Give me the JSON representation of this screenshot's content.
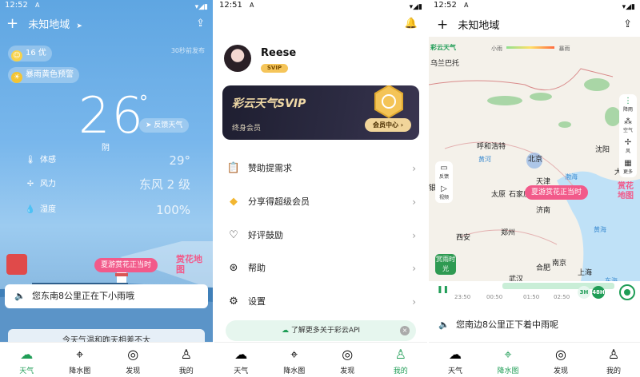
{
  "screen1": {
    "status": {
      "time": "12:52",
      "sim": "A"
    },
    "location": "未知地域",
    "aqi": "16 优",
    "alert": "暴雨黄色预警",
    "update": "30秒前发布",
    "temp": "26",
    "degree": "°",
    "feedback": "反馈天气",
    "condition": "阴",
    "details": [
      {
        "label": "体感",
        "value": "29°"
      },
      {
        "label": "风力",
        "value": "东风 2 级"
      },
      {
        "label": "湿度",
        "value": "100%"
      }
    ],
    "promo": "夏游赏花正当时",
    "promo_logo": "赏花地图",
    "notice": "您东南8公里正在下小雨哦",
    "summary": "今天气温和昨天相差不大"
  },
  "screen2": {
    "status": {
      "time": "12:51",
      "sim": "A"
    },
    "username": "Reese",
    "badge": "SVIP",
    "card_title": "彩云天气SVIP",
    "card_sub": "终身会员",
    "card_button": "会员中心 ›",
    "menu": [
      {
        "label": "赞助提需求",
        "icon": "clipboard-icon"
      },
      {
        "label": "分享得超级会员",
        "icon": "diamond-icon"
      },
      {
        "label": "好评鼓励",
        "icon": "heart-icon"
      },
      {
        "label": "帮助",
        "icon": "lifebuoy-icon"
      },
      {
        "label": "设置",
        "icon": "settings-icon"
      }
    ],
    "api_banner": "了解更多关于彩云API"
  },
  "screen3": {
    "status": {
      "time": "12:52",
      "sim": "A"
    },
    "location": "未知地域",
    "brand": "彩云天气",
    "legend": {
      "light": "小雨",
      "heavy": "暴雨"
    },
    "side_buttons": [
      "降雨",
      "空气",
      "风",
      "更多"
    ],
    "left_buttons": [
      "反馈",
      "视频"
    ],
    "cities": [
      "乌兰巴托",
      "呼和浩特",
      "北京",
      "沈阳",
      "天津",
      "渤海",
      "太原",
      "石家庄",
      "济南",
      "黄海",
      "西安",
      "郑州",
      "合肥",
      "南京",
      "上海",
      "武汉",
      "东海",
      "银川",
      "黄河",
      "大连"
    ],
    "promo": "夏游赏花正当时",
    "promo_logo": "赏花地图",
    "bottom_logo": "赏雨时光",
    "times": [
      "23:50",
      "00:50",
      "01:50",
      "02:50"
    ],
    "modes": [
      "3H",
      "48H"
    ],
    "notice": "您南边8公里正下着中雨呢"
  },
  "tabs": [
    "天气",
    "降水图",
    "发现",
    "我的"
  ]
}
